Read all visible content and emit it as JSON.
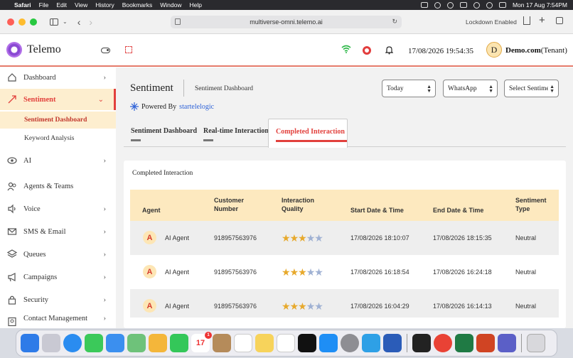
{
  "menubar": {
    "app": "Safari",
    "items": [
      "File",
      "Edit",
      "View",
      "History",
      "Bookmarks",
      "Window",
      "Help"
    ],
    "datetime": "Mon 17 Aug  7:54PM"
  },
  "browser": {
    "url": "multiverse-omni.telemo.ai",
    "lockdown": "Lockdown Enabled"
  },
  "header": {
    "brand": "Telemo",
    "datetime": "17/08/2026 19:54:35",
    "avatar_letter": "D",
    "tenant_name": "Demo.com",
    "tenant_suffix": "(Tenant)"
  },
  "sidebar": {
    "items": [
      {
        "label": "Dashboard"
      },
      {
        "label": "Sentiment"
      },
      {
        "label": "AI"
      },
      {
        "label": "Agents & Teams"
      },
      {
        "label": "Voice"
      },
      {
        "label": "SMS & Email"
      },
      {
        "label": "Queues"
      },
      {
        "label": "Campaigns"
      },
      {
        "label": "Security"
      },
      {
        "label": "Contact Management"
      }
    ],
    "subitems": [
      {
        "label": "Sentiment Dashboard"
      },
      {
        "label": "Keyword Analysis"
      }
    ]
  },
  "page": {
    "title": "Sentiment",
    "breadcrumb": "Sentiment Dashboard",
    "powered_by": "Powered By",
    "powered_brand": "startelelogic",
    "filters": {
      "date": "Today",
      "channel": "WhatsApp",
      "sentiment": "Select Sentiment"
    },
    "tabs": [
      {
        "label": "Sentiment Dashboard"
      },
      {
        "label": "Real-time Interaction"
      },
      {
        "label": "Completed Interaction"
      }
    ],
    "active_tab": "Completed Interaction"
  },
  "table": {
    "title": "Completed Interaction",
    "headers": {
      "agent": "Agent",
      "customer_1": "Customer",
      "customer_2": "Number",
      "quality_1": "Interaction",
      "quality_2": "Quality",
      "start": "Start Date & Time",
      "end": "End Date & Time",
      "sentiment_1": "Sentiment",
      "sentiment_2": "Type"
    },
    "rows": [
      {
        "badge": "A",
        "agent": "AI Agent",
        "number": "918957563976",
        "rating": 3,
        "start": "17/08/2026 18:10:07",
        "end": "17/08/2026 18:15:35",
        "sentiment": "Neutral"
      },
      {
        "badge": "A",
        "agent": "AI Agent",
        "number": "918957563976",
        "rating": 3,
        "start": "17/08/2026 16:18:54",
        "end": "17/08/2026 16:24:18",
        "sentiment": "Neutral"
      },
      {
        "badge": "A",
        "agent": "AI Agent",
        "number": "918957563976",
        "rating": 3,
        "start": "17/08/2026 16:04:29",
        "end": "17/08/2026 16:14:13",
        "sentiment": "Neutral"
      }
    ],
    "rating_max": 5
  },
  "dock": {
    "calendar_day": "17",
    "calendar_badge": "1"
  },
  "colors": {
    "accent": "#e2403c",
    "highlight": "#fdeecf",
    "table_header": "#fde9bf",
    "star_on": "#e7a92c",
    "star_off": "#9fb1d3"
  }
}
